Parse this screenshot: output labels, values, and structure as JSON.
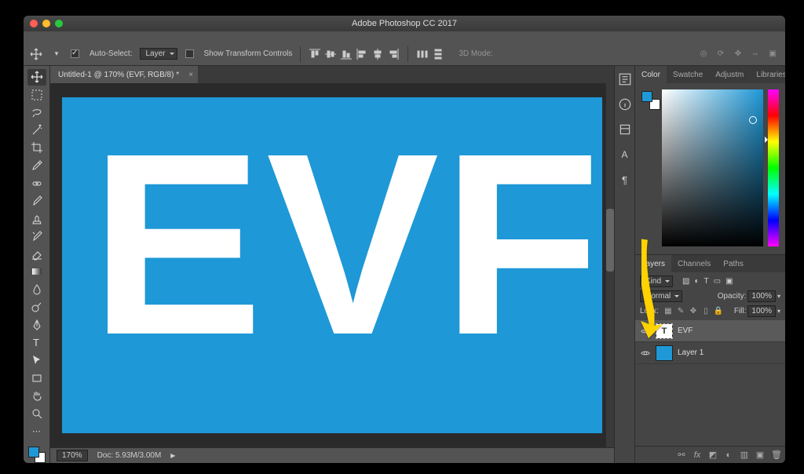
{
  "window": {
    "title": "Adobe Photoshop CC 2017"
  },
  "options": {
    "auto_select_label": "Auto-Select:",
    "auto_select_target": "Layer",
    "show_transform_label": "Show Transform Controls",
    "mode_label": "3D Mode:"
  },
  "document": {
    "tab_title": "Untitled-1 @ 170% (EVF, RGB/8) *",
    "canvas_text": "EVF",
    "canvas_bg": "#1e98d7",
    "zoom": "170%",
    "doc_size": "Doc: 5.93M/3.00M"
  },
  "panels": {
    "color_tabs": [
      "Color",
      "Swatche",
      "Adjustm",
      "Libraries"
    ],
    "layers_tabs": [
      "Layers",
      "Channels",
      "Paths"
    ],
    "layers": {
      "filter_label": "Kind",
      "blend_mode": "Normal",
      "opacity_label": "Opacity:",
      "opacity_value": "100%",
      "lock_label": "Lock:",
      "fill_label": "Fill:",
      "fill_value": "100%",
      "items": [
        {
          "name": "EVF",
          "type": "text",
          "selected": true
        },
        {
          "name": "Layer 1",
          "type": "fill",
          "selected": false
        }
      ]
    }
  },
  "tool_names": [
    "move-tool",
    "marquee-tool",
    "lasso-tool",
    "magic-wand-tool",
    "crop-tool",
    "eyedropper-tool",
    "spot-heal-tool",
    "brush-tool",
    "clone-stamp-tool",
    "history-brush-tool",
    "eraser-tool",
    "gradient-tool",
    "blur-tool",
    "dodge-tool",
    "pen-tool",
    "type-tool",
    "path-select-tool",
    "rectangle-tool",
    "hand-tool",
    "zoom-tool"
  ],
  "dock_icons": [
    "history-icon",
    "properties-icon",
    "info-icon",
    "character-icon",
    "paragraph-icon",
    "glyphs-icon"
  ]
}
